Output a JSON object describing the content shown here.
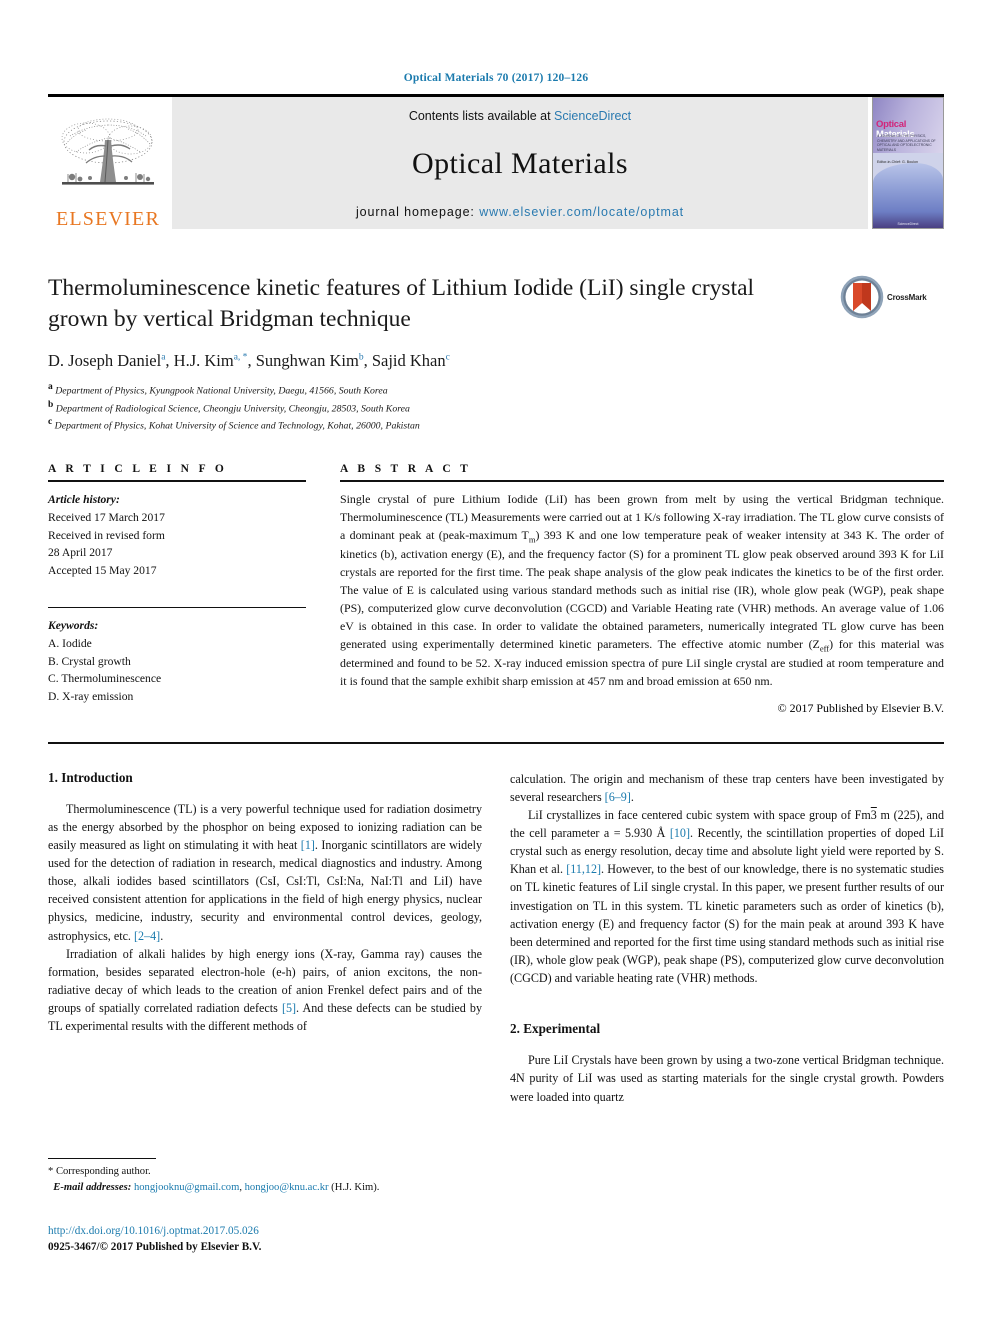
{
  "running_head": "Optical Materials 70 (2017) 120–126",
  "masthead": {
    "contents_prefix": "Contents lists available at ",
    "sciencedirect": "ScienceDirect",
    "journal_name": "Optical Materials",
    "homepage_prefix": "journal homepage: ",
    "homepage_url": "www.elsevier.com/locate/optmat",
    "publisher_word": "ELSEVIER",
    "cover": {
      "title_1": "Optical",
      "title_2": "Materials",
      "subtitle": "A JOURNAL ON THE PHYSICS, CHEMISTRY AND APPLICATIONS OF OPTICAL AND OPTOELECTRONIC MATERIALS",
      "byline": "Editor-in-Chief:  G. Boulon",
      "footer": "ScienceDirect",
      "colors": {
        "title_optical": "#d2257a",
        "title_materials": "#ffffff"
      }
    }
  },
  "article": {
    "title": "Thermoluminescence kinetic features of Lithium Iodide (LiI) single crystal grown by vertical Bridgman technique",
    "crossmark_label": "CrossMark",
    "authors": [
      {
        "name": "D. Joseph Daniel",
        "marks": "a"
      },
      {
        "name": "H.J. Kim",
        "marks": "a, *"
      },
      {
        "name": "Sunghwan Kim",
        "marks": "b"
      },
      {
        "name": "Sajid Khan",
        "marks": "c"
      }
    ],
    "affiliations": [
      {
        "mark": "a",
        "text": "Department of Physics, Kyungpook National University, Daegu, 41566, South Korea"
      },
      {
        "mark": "b",
        "text": "Department of Radiological Science, Cheongju University, Cheongju, 28503, South Korea"
      },
      {
        "mark": "c",
        "text": "Department of Physics, Kohat University of Science and Technology, Kohat, 26000, Pakistan"
      }
    ]
  },
  "info": {
    "label": "A R T I C L E   I N F O",
    "history_heading": "Article history:",
    "history": [
      "Received 17 March 2017",
      "Received in revised form",
      "28 April 2017",
      "Accepted 15 May 2017"
    ],
    "keywords_heading": "Keywords:",
    "keywords": [
      "A. Iodide",
      "B. Crystal growth",
      "C. Thermoluminescence",
      "D. X-ray emission"
    ]
  },
  "abstract": {
    "label": "A B S T R A C T",
    "text_part_1": "Single crystal of pure Lithium Iodide (LiI) has been grown from melt by using the vertical Bridgman technique. Thermoluminescence (TL) Measurements were carried out at 1 K/s following X-ray irradiation. The TL glow curve consists of a dominant peak at (peak-maximum T",
    "tm_sub": "m",
    "text_part_2": ") 393 K and one low temperature peak of weaker intensity at 343 K. The order of kinetics (b), activation energy (E), and the frequency factor (S) for a prominent TL glow peak observed around 393 K for LiI crystals are reported for the first time. The peak shape analysis of the glow peak indicates the kinetics to be of the first order. The value of E is calculated using various standard methods such as initial rise (IR), whole glow peak (WGP), peak shape (PS), computerized glow curve deconvolution (CGCD) and Variable Heating rate (VHR) methods. An average value of 1.06 eV is obtained in this case. In order to validate the obtained parameters, numerically integrated TL glow curve has been generated using experimentally determined kinetic parameters. The effective atomic number (Z",
    "zeff_sub": "eff",
    "text_part_3": ") for this material was determined and found to be 52. X-ray induced emission spectra of pure LiI single crystal are studied at room temperature and it is found that the sample exhibit sharp emission at 457 nm and broad emission at 650 nm.",
    "copyright": "© 2017 Published by Elsevier B.V."
  },
  "body": {
    "section_1_title": "1. Introduction",
    "section_2_title": "2. Experimental",
    "left": {
      "p1_a": "Thermoluminescence (TL) is a very powerful technique used for radiation dosimetry as the energy absorbed by the phosphor on being exposed to ionizing radiation can be easily measured as light on stimulating it with heat ",
      "p1_ref1": "[1]",
      "p1_b": ". Inorganic scintillators are widely used for the detection of radiation in research, medical diagnostics and industry. Among those, alkali iodides based scintillators (CsI, CsI:Tl, CsI:Na, NaI:Tl and LiI) have received consistent attention for applications in the field of high energy physics, nuclear physics, medicine, industry, security and environmental control devices, geology, astrophysics, etc. ",
      "p1_ref2": "[2–4]",
      "p1_c": ".",
      "p2_a": "Irradiation of alkali halides by high energy ions (X-ray, Gamma ray) causes the formation, besides separated electron-hole (e-h) pairs, of anion excitons, the non-radiative decay of which leads to the creation of anion Frenkel defect pairs and of the groups of spatially correlated radiation defects ",
      "p2_ref": "[5]",
      "p2_b": ". And these defects can be studied by TL experimental results with the different methods of"
    },
    "right": {
      "p1_a": "calculation. The origin and mechanism of these trap centers have been investigated by several researchers ",
      "p1_ref": "[6–9]",
      "p1_b": ".",
      "p2_a": "LiI crystallizes in face centered cubic system with space group of Fm",
      "p2_overline": "3",
      "p2_b": " m (225), and the cell parameter a = 5.930 Å ",
      "p2_ref1": "[10]",
      "p2_c": ". Recently, the scintillation properties of doped LiI crystal such as energy resolution, decay time and absolute light yield were reported by S. Khan et al. ",
      "p2_ref2": "[11,12]",
      "p2_d": ". However, to the best of our knowledge, there is no systematic studies on TL kinetic features of LiI single crystal. In this paper, we present further results of our investigation on TL in this system. TL kinetic parameters such as order of kinetics (b), activation energy (E) and frequency factor (S) for the main peak at around 393 K have been determined and reported for the first time using standard methods such as initial rise (IR), whole glow peak (WGP), peak shape (PS), computerized glow curve deconvolution (CGCD) and variable heating rate (VHR) methods.",
      "p3": "Pure LiI Crystals have been grown by using a two-zone vertical Bridgman technique. 4N purity of LiI was used as starting materials for the single crystal growth. Powders were loaded into quartz"
    }
  },
  "footnote": {
    "corresponding": "* Corresponding author.",
    "email_label": "E-mail addresses:",
    "email_1": "hongjooknu@gmail.com",
    "email_sep": ", ",
    "email_2": "hongjoo@knu.ac.kr",
    "email_suffix": " (H.J. Kim)."
  },
  "doi": {
    "url": "http://dx.doi.org/10.1016/j.optmat.2017.05.026",
    "issn_line": "0925-3467/© 2017 Published by Elsevier B.V."
  },
  "colors": {
    "link": "#1a7aad",
    "masthead_link": "#2a7ab0",
    "elsevier_orange": "#e87722",
    "masthead_bg": "#e9e9e9"
  }
}
